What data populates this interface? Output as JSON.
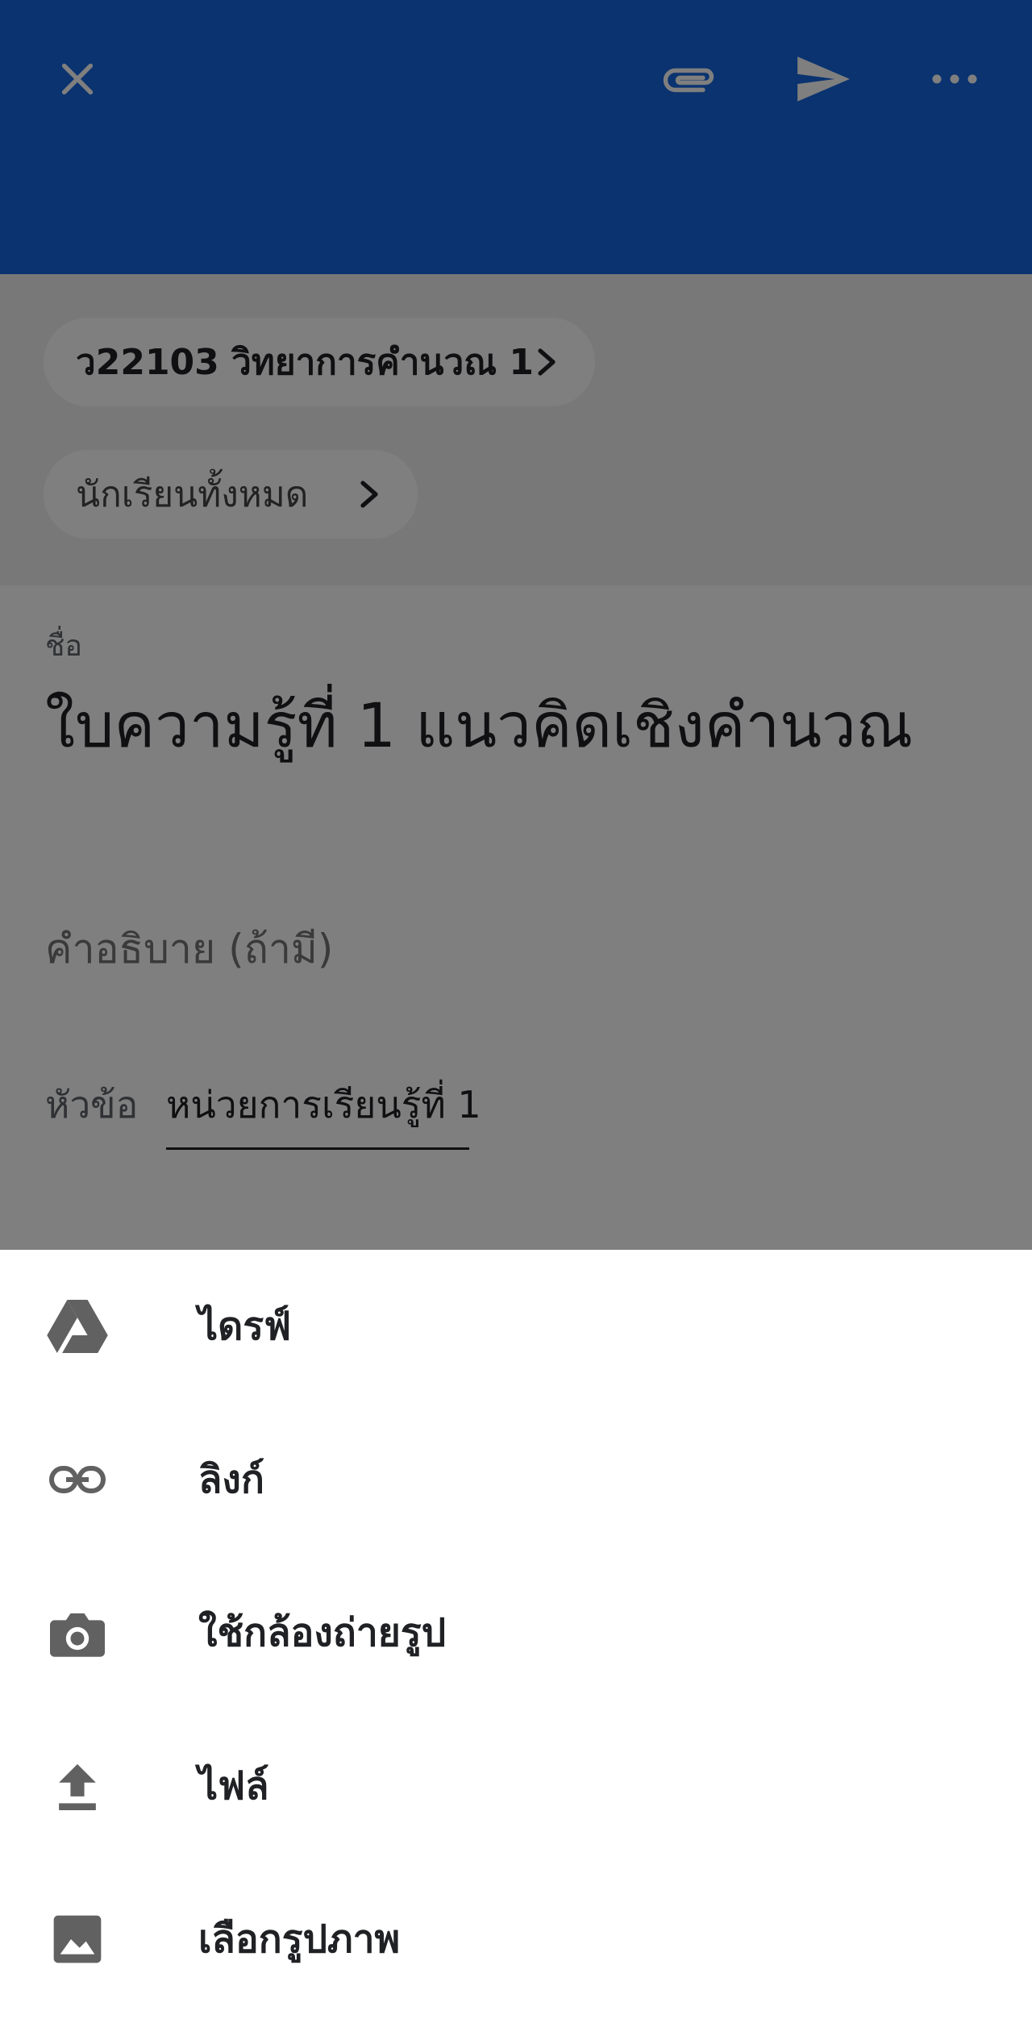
{
  "colors": {
    "topbar": "#1467de",
    "chip_bg": "#ffffff",
    "scrim": "rgba(0,0,0,0.5)",
    "icon_gray": "#616161"
  },
  "toolbar": {
    "close_icon": "close-icon",
    "attach_icon": "paperclip-icon",
    "send_icon": "send-icon",
    "more_icon": "more-horizontal-icon"
  },
  "audience": {
    "class_label": "ว22103 วิทยาการคำนวณ 1",
    "students_label": "นักเรียนทั้งหมด"
  },
  "form": {
    "title_label": "ชื่อ",
    "title_value": "ใบความรู้ที่ 1 แนวคิดเชิงคำนวณ",
    "description_placeholder": "คำอธิบาย (ถ้ามี)",
    "topic_label": "หัวข้อ",
    "topic_value": "หน่วยการเรียนรู้ที่ 1"
  },
  "attach_menu": {
    "items": [
      {
        "label": "ไดรฟ์",
        "icon": "drive-icon"
      },
      {
        "label": "ลิงก์",
        "icon": "link-icon"
      },
      {
        "label": "ใช้กล้องถ่ายรูป",
        "icon": "camera-icon"
      },
      {
        "label": "ไฟล์",
        "icon": "upload-icon"
      },
      {
        "label": "เลือกรูปภาพ",
        "icon": "image-icon"
      }
    ]
  }
}
